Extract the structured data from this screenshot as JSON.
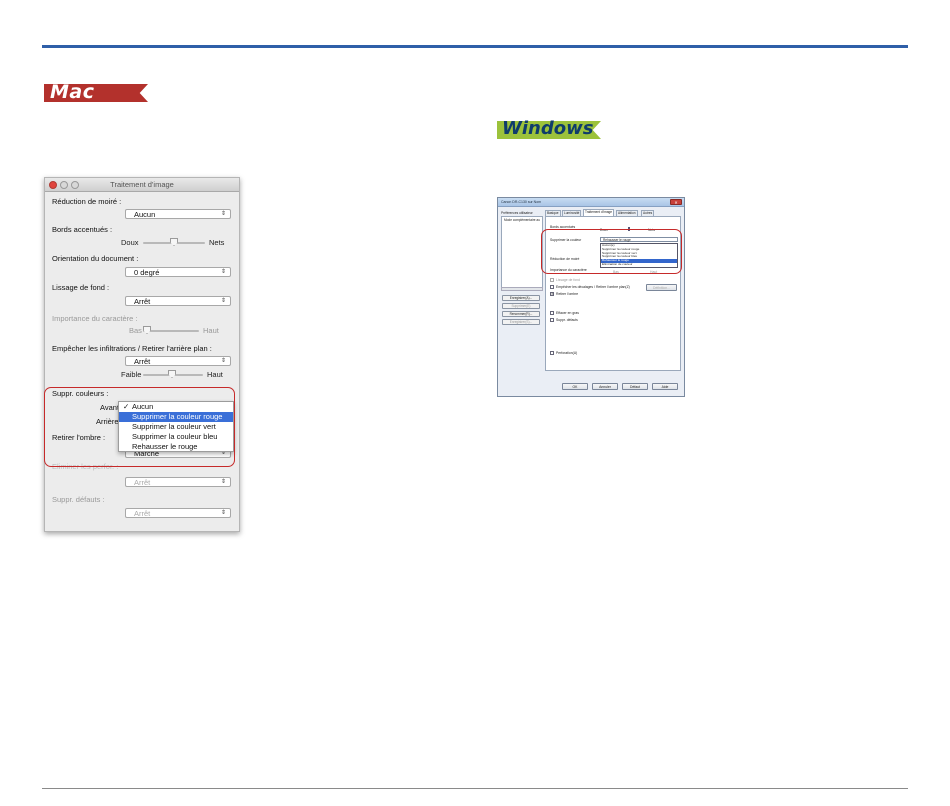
{
  "mac": {
    "badge": "Mac",
    "window_title": "Traitement d'image",
    "moire_label": "Réduction de moiré :",
    "moire_value": "Aucun",
    "edges_label": "Bords accentués :",
    "edges_low": "Doux",
    "edges_high": "Nets",
    "orientation_label": "Orientation du document :",
    "orientation_value": "0 degré",
    "smoothing_label": "Lissage de fond :",
    "smoothing_value": "Arrêt",
    "importance_label": "Importance du caractère :",
    "importance_low": "Bas",
    "importance_high": "Haut",
    "bleed_label": "Empêcher les infiltrations / Retirer l'arrière plan :",
    "bleed_value": "Arrêt",
    "bleed_low": "Faible",
    "bleed_high": "Haut",
    "dropout_label": "Suppr. couleurs :",
    "front_label": "Avant",
    "back_label": "Arrière",
    "dropout_options": [
      "Aucun",
      "Supprimer la couleur rouge",
      "Supprimer la couleur vert",
      "Supprimer la couleur bleu",
      "Rehausser le rouge"
    ],
    "dropout_check": "✓",
    "shadow_label": "Retirer l'ombre :",
    "shadow_value": "Marche",
    "punch_label": "Eliminer les perfor. :",
    "punch_value": "Arrêt",
    "defects_label": "Suppr. défauts :",
    "defects_value": "Arrêt"
  },
  "windows": {
    "badge": "Windows",
    "dialog_title": "Canon DR-C130 sur Nom",
    "close_glyph": "✕",
    "presets_label": "Préférences utilisateur",
    "presets_list": [
      "Mode complémentaire au"
    ],
    "left_buttons": [
      "Enregistrer(A)...",
      "Supprimer(E)",
      "Renommer(R)...",
      "Enregistrer(S)..."
    ],
    "tabs": [
      "Basique",
      "Luminosité",
      "Traitement d'image",
      "Alimentation",
      "Autres"
    ],
    "edges_label": "Bords accentués",
    "edges_low": "Doux",
    "edges_high": "Nets",
    "dropout_label": "Supprimer la couleur",
    "dropout_value": "Rehausser le rouge",
    "dropout_options": [
      "Aucun(e)",
      "Supprimer la couleur rouge",
      "Supprimer la couleur vert",
      "Supprimer la couleur bleu",
      "Rehausser le rouge",
      "Élimination de couleur"
    ],
    "moire_label": "Réduction de moiré",
    "importance_label": "Importance du caractère",
    "importance_low": "Bas",
    "importance_high": "Haut",
    "smoothing_label": "Lissage de fond",
    "bleed_label": "Empêcher les décalages / Retirer l'ombre plan(Z)",
    "settings_button": "Définition...",
    "shadow_label": "Retirer l'ombre",
    "erase_label": "Effacer en gras",
    "defects_label": "Suppr. défauts",
    "punch_label": "Perforation(U)",
    "bottom_buttons": [
      "OK",
      "Annuler",
      "Défaut",
      "Aide"
    ]
  }
}
